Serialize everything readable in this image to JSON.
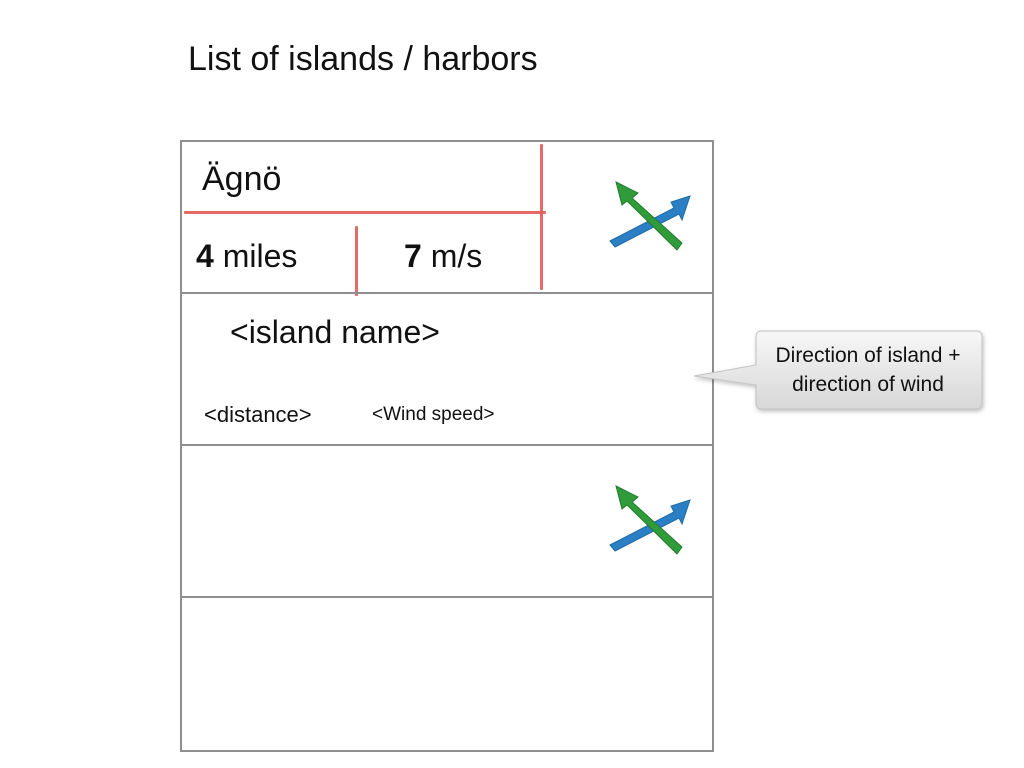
{
  "title": "List of islands / harbors",
  "rows": [
    {
      "name": "Ägnö",
      "distance_value": "4",
      "distance_unit": " miles",
      "wind_value": "7",
      "wind_unit": " m/s",
      "annotated": true
    },
    {
      "name": "<island name>",
      "distance": "<distance>",
      "wind": "<Wind speed>",
      "placeholder": true
    },
    {
      "empty": true
    },
    {
      "empty": true
    }
  ],
  "arrows": {
    "island_direction_color": "#2f9b3a",
    "wind_direction_color": "#2b7fc4",
    "icon": "direction-arrows-icon"
  },
  "callout": {
    "line1": "Direction of island +",
    "line2": "direction of wind"
  },
  "colors": {
    "grid_border": "#8f8f8f",
    "annotation_red": "#e25a57"
  }
}
